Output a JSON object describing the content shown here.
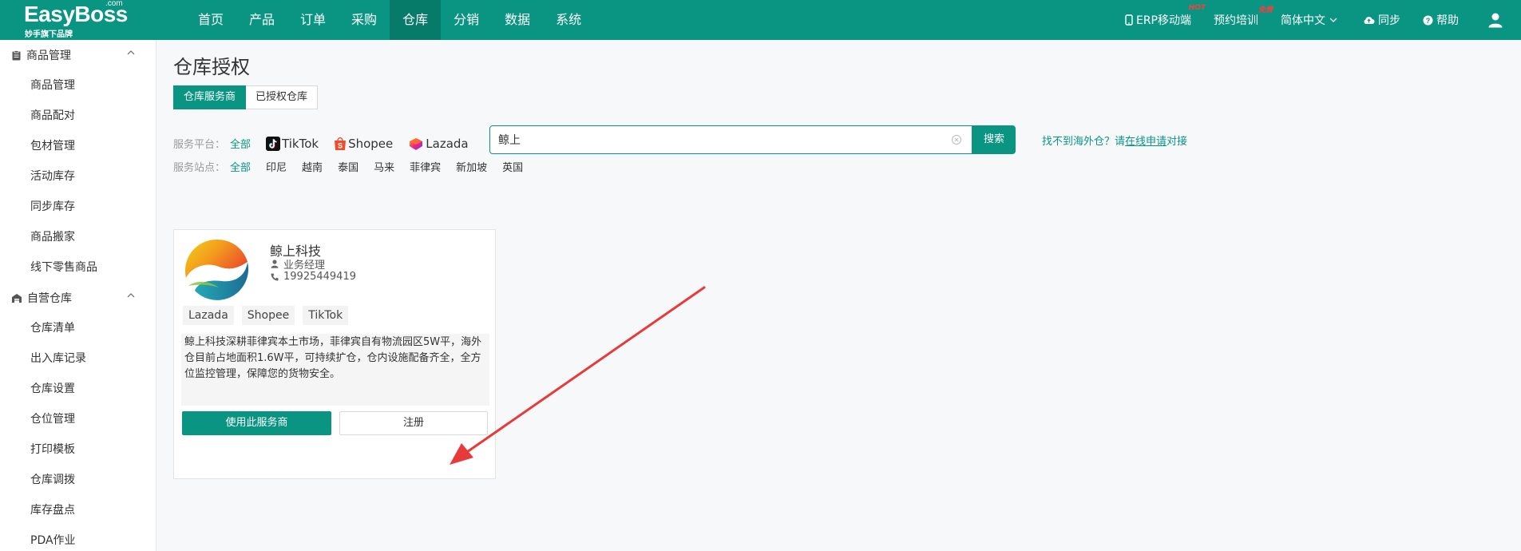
{
  "brand": {
    "name": "EasyBoss",
    "com": ".com",
    "subtitle": "妙手旗下品牌"
  },
  "nav": {
    "items": [
      "首页",
      "产品",
      "订单",
      "采购",
      "仓库",
      "分销",
      "数据",
      "系统"
    ],
    "active": "仓库"
  },
  "topbar_right": {
    "erp": "ERP移动端",
    "erp_badge": "HOT",
    "training": "预约培训",
    "training_badge": "免费",
    "language": "简体中文",
    "sync": "同步",
    "help": "帮助"
  },
  "sidebar": {
    "groups": [
      {
        "title": "商品管理",
        "items": [
          "商品管理",
          "商品配对",
          "包材管理",
          "活动库存",
          "同步库存",
          "商品搬家",
          "线下零售商品"
        ]
      },
      {
        "title": "自营仓库",
        "items": [
          "仓库清单",
          "出入库记录",
          "仓库设置",
          "仓位管理",
          "打印模板",
          "仓库调拨",
          "库存盘点",
          "PDA作业"
        ]
      }
    ]
  },
  "page": {
    "title": "仓库授权",
    "tabs": [
      "仓库服务商",
      "已授权仓库"
    ],
    "active_tab": "仓库服务商"
  },
  "search": {
    "value": "鲸上",
    "button": "搜索",
    "tip_prefix": "找不到海外仓？请",
    "tip_link": "在线申请",
    "tip_suffix": "对接"
  },
  "filters": {
    "platform_label": "服务平台：",
    "platforms": [
      "全部",
      "TikTok",
      "Shopee",
      "Lazada"
    ],
    "platform_active": "全部",
    "site_label": "服务站点：",
    "sites": [
      "全部",
      "印尼",
      "越南",
      "泰国",
      "马来",
      "菲律宾",
      "新加坡",
      "英国"
    ],
    "site_active": "全部"
  },
  "card": {
    "name": "鲸上科技",
    "contact": "业务经理",
    "phone": "19925449419",
    "tags": [
      "Lazada",
      "Shopee",
      "TikTok"
    ],
    "description": "鲸上科技深耕菲律宾本土市场，菲律宾自有物流园区5W平，海外仓目前占地面积1.6W平，可持续扩仓，仓内设施配备齐全，全方位监控管理，保障您的货物安全。",
    "primary_button": "使用此服务商",
    "secondary_button": "注册"
  },
  "colors": {
    "accent": "#0a9582",
    "accent_dark": "#067b6a",
    "annotation": "#e83a3a"
  }
}
